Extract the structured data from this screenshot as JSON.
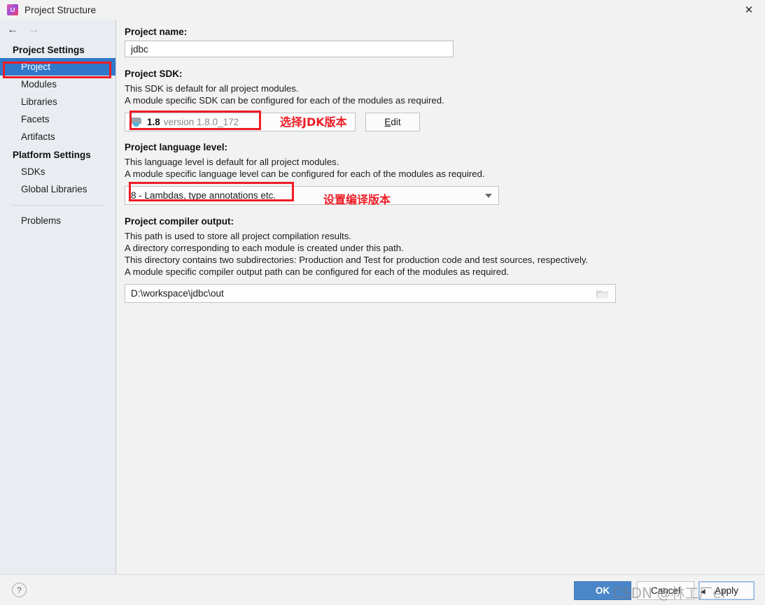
{
  "window": {
    "title": "Project Structure",
    "app_icon": "intellij-idea-icon",
    "close_icon": "✕"
  },
  "nav": {
    "back_icon": "←",
    "forward_icon": "→"
  },
  "sidebar": {
    "groups": [
      {
        "header": "Project Settings",
        "items": [
          {
            "label": "Project",
            "selected": true
          },
          {
            "label": "Modules",
            "selected": false
          },
          {
            "label": "Libraries",
            "selected": false
          },
          {
            "label": "Facets",
            "selected": false
          },
          {
            "label": "Artifacts",
            "selected": false
          }
        ]
      },
      {
        "header": "Platform Settings",
        "items": [
          {
            "label": "SDKs",
            "selected": false
          },
          {
            "label": "Global Libraries",
            "selected": false
          }
        ]
      }
    ],
    "extra_items": [
      {
        "label": "Problems",
        "selected": false
      }
    ]
  },
  "main": {
    "project_name": {
      "label": "Project name:",
      "value": "jdbc"
    },
    "project_sdk": {
      "label": "Project SDK:",
      "desc_line1": "This SDK is default for all project modules.",
      "desc_line2": "A module specific SDK can be configured for each of the modules as required.",
      "sdk_name": "1.8",
      "sdk_version": "version 1.8.0_172",
      "sdk_icon": "java-sdk-icon",
      "edit_button": "Edit",
      "edit_mnemonic": "E",
      "edit_rest": "dit"
    },
    "project_language_level": {
      "label": "Project language level:",
      "desc_line1": "This language level is default for all project modules.",
      "desc_line2": "A module specific language level can be configured for each of the modules as required.",
      "value": "8 - Lambdas, type annotations etc.",
      "dropdown_icon": "chevron-down-icon"
    },
    "project_compiler_output": {
      "label": "Project compiler output:",
      "desc_line1": "This path is used to store all project compilation results.",
      "desc_line2": "A directory corresponding to each module is created under this path.",
      "desc_line3": "This directory contains two subdirectories: Production and Test for production code and test sources, respectively.",
      "desc_line4": "A module specific compiler output path can be configured for each of the modules as required.",
      "value": "D:\\workspace\\jdbc\\out",
      "browse_icon": "folder-icon"
    }
  },
  "annotations": [
    {
      "name": "select-jdk-version-note",
      "text": "选择JDK版本"
    },
    {
      "name": "set-compile-version-note",
      "text": "设置编译版本"
    }
  ],
  "footer": {
    "help_icon": "?",
    "ok_label": "OK",
    "cancel_label": "Cancel",
    "apply_label": "Apply"
  },
  "watermark": {
    "text": "CSDN @林工厂er"
  },
  "colors": {
    "accent_blue": "#2f78c9",
    "ok_blue": "#4a86c8",
    "annotation_red": "#ee1c25",
    "sidebar_bg": "#e9edf2",
    "window_bg": "#f2f2f2"
  }
}
